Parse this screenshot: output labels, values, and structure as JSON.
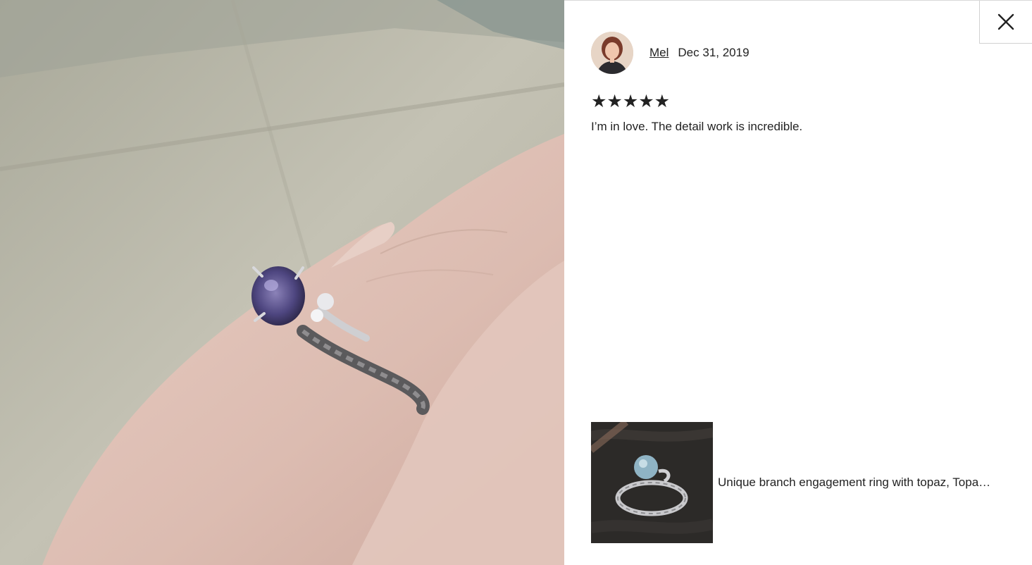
{
  "photo": {
    "icon": "review-photo-ring-on-hand"
  },
  "close": {
    "icon": "close-icon"
  },
  "review": {
    "reviewer_name": "Mel",
    "date": "Dec 31, 2019",
    "rating_stars": "★★★★★",
    "rating_value": 5,
    "rating_max": 5,
    "text": "I’m in love. The detail work is incredible."
  },
  "product": {
    "title": "Unique branch engagement ring with topaz, Topa…",
    "thumbnail_icon": "ring-product-thumbnail"
  },
  "colors": {
    "text": "#222222",
    "panel_bg": "#ffffff",
    "border": "#d1d1d1"
  }
}
